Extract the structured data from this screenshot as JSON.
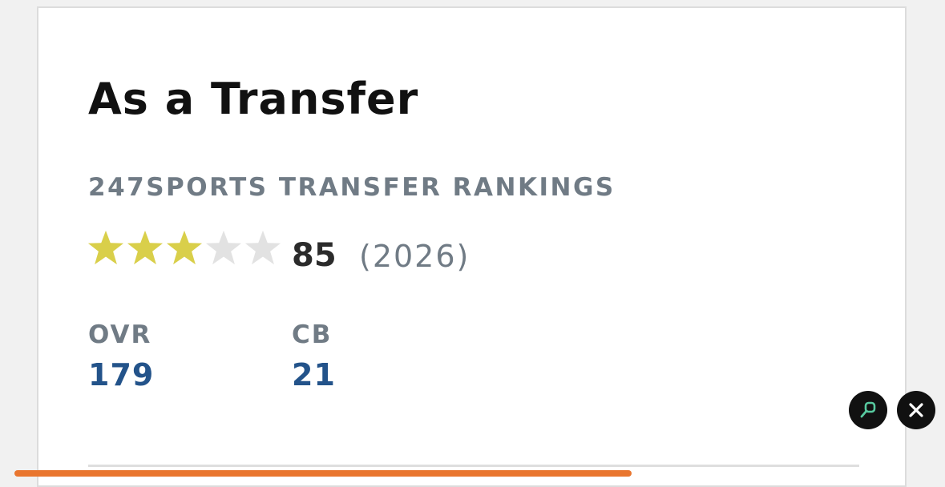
{
  "section": {
    "title": "As a Transfer",
    "subtitle": "247SPORTS TRANSFER RANKINGS"
  },
  "rating": {
    "stars_filled": 3,
    "stars_total": 5,
    "score": "85",
    "year": "(2026)"
  },
  "stats": [
    {
      "label": "OVR",
      "value": "179"
    },
    {
      "label": "CB",
      "value": "21"
    }
  ],
  "floating_buttons": {
    "left_icon": "link-icon",
    "right_icon": "close-icon"
  },
  "colors": {
    "star_filled": "#d9cf4a",
    "star_empty": "#e2e2e2",
    "stat_value": "#23538a",
    "label_gray": "#707b85",
    "link_icon": "#57c99f",
    "orange_bar": "#e9762f"
  }
}
